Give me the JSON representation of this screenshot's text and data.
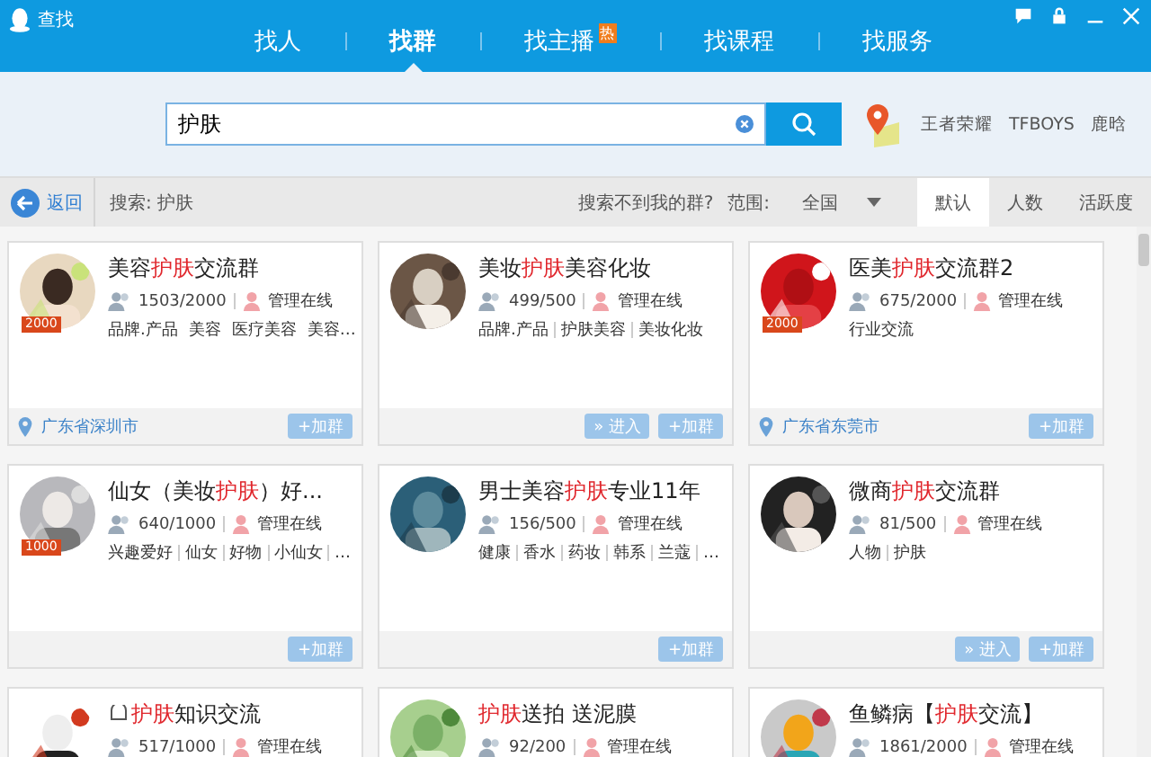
{
  "window": {
    "title": "查找"
  },
  "nav_tabs": [
    {
      "label": "找人",
      "selected": false
    },
    {
      "label": "找群",
      "selected": true
    },
    {
      "label": "找主播",
      "selected": false,
      "badge": "热"
    },
    {
      "label": "找课程",
      "selected": false
    },
    {
      "label": "找服务",
      "selected": false
    }
  ],
  "search": {
    "value": "护肤"
  },
  "hot_keywords": [
    "王者荣耀",
    "TFBOYS",
    "鹿晗"
  ],
  "toolbar": {
    "back": "返回",
    "query": "搜索: 护肤",
    "not_found_link": "搜索不到我的群?",
    "scope_label": "范围:",
    "scope_value": "全国",
    "sort_tabs": [
      {
        "label": "默认",
        "selected": true
      },
      {
        "label": "人数",
        "selected": false
      },
      {
        "label": "活跃度",
        "selected": false
      }
    ]
  },
  "groups": [
    {
      "title": [
        {
          "text": "美容",
          "highlight": false
        },
        {
          "text": "护肤",
          "highlight": true
        },
        {
          "text": "交流群",
          "highlight": false
        }
      ],
      "level_badge": "2000",
      "members": "1503/2000",
      "admin": "管理在线",
      "tags": [
        "品牌.产品",
        "美容",
        "医疗美容",
        "美容…"
      ],
      "location": "广东省深圳市",
      "join": "+加群"
    },
    {
      "title": [
        {
          "text": "美妆",
          "highlight": false
        },
        {
          "text": "护肤",
          "highlight": true
        },
        {
          "text": "美容化妆",
          "highlight": false
        }
      ],
      "members": "499/500",
      "admin": "管理在线",
      "tags": [
        "品牌.产品",
        "护肤美容",
        "美妆化妆"
      ],
      "enter": "» 进入",
      "join": "+加群"
    },
    {
      "title": [
        {
          "text": "医美",
          "highlight": false
        },
        {
          "text": "护肤",
          "highlight": true
        },
        {
          "text": "交流群2",
          "highlight": false
        }
      ],
      "level_badge": "2000",
      "members": "675/2000",
      "admin": "管理在线",
      "tags": [
        "行业交流"
      ],
      "location": "广东省东莞市",
      "join": "+加群"
    },
    {
      "title": [
        {
          "text": "仙女（美妆",
          "highlight": false
        },
        {
          "text": "护肤",
          "highlight": true
        },
        {
          "text": "）好...",
          "highlight": false
        }
      ],
      "level_badge": "1000",
      "members": "640/1000",
      "admin": "管理在线",
      "tags": [
        "兴趣爱好",
        "仙女",
        "好物",
        "小仙女",
        "…"
      ],
      "join": "+加群"
    },
    {
      "title": [
        {
          "text": "男士美容",
          "highlight": false
        },
        {
          "text": "护肤",
          "highlight": true
        },
        {
          "text": "专业11年",
          "highlight": false
        }
      ],
      "members": "156/500",
      "admin": "管理在线",
      "tags": [
        "健康",
        "香水",
        "药妆",
        "韩系",
        "兰蔻",
        "…"
      ],
      "join": "+加群"
    },
    {
      "title": [
        {
          "text": "微商",
          "highlight": false
        },
        {
          "text": "护肤",
          "highlight": true
        },
        {
          "text": "交流群",
          "highlight": false
        }
      ],
      "members": "81/500",
      "admin": "管理在线",
      "tags": [
        "人物",
        "护肤"
      ],
      "enter": "» 进入",
      "join": "+加群"
    },
    {
      "title": [
        {
          "text": "护肤",
          "highlight": true
        },
        {
          "text": "知识交流",
          "highlight": false
        }
      ],
      "title_icon": true,
      "members": "517/1000",
      "admin": "管理在线"
    },
    {
      "title": [
        {
          "text": "护肤",
          "highlight": true
        },
        {
          "text": "送拍 送泥膜",
          "highlight": false
        }
      ],
      "members": "92/200",
      "admin": "管理在线"
    },
    {
      "title": [
        {
          "text": "鱼鳞病【",
          "highlight": false
        },
        {
          "text": "护肤",
          "highlight": true
        },
        {
          "text": "交流】",
          "highlight": false
        }
      ],
      "members": "1861/2000",
      "admin": "管理在线"
    }
  ]
}
